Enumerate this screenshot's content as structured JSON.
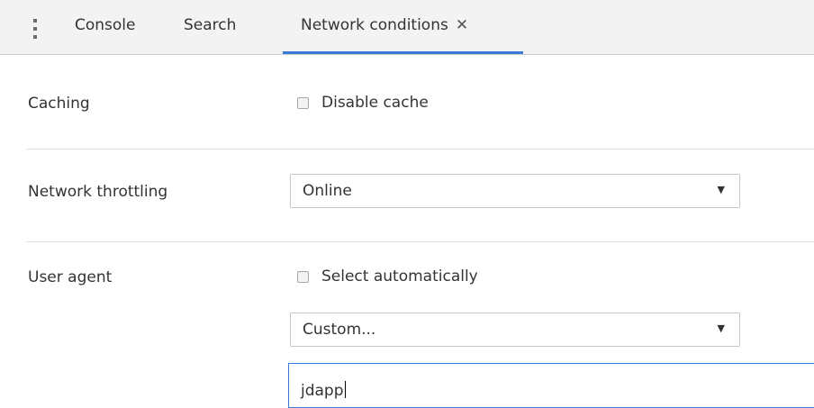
{
  "tabs": {
    "console": "Console",
    "search": "Search",
    "network_conditions": "Network conditions",
    "close_glyph": "✕"
  },
  "caching": {
    "label": "Caching",
    "disable_cache_label": "Disable cache",
    "disable_cache_checked": false
  },
  "throttling": {
    "label": "Network throttling",
    "selected": "Online"
  },
  "user_agent": {
    "label": "User agent",
    "select_automatically_label": "Select automatically",
    "select_automatically_checked": false,
    "selected": "Custom...",
    "custom_value": "jdapp"
  },
  "icons": {
    "menu": "kebab-menu-icon",
    "close": "close-icon",
    "dropdown": "dropdown-arrow-icon"
  },
  "colors": {
    "accent": "#3879d9",
    "tabbar_bg": "#f3f3f3"
  }
}
